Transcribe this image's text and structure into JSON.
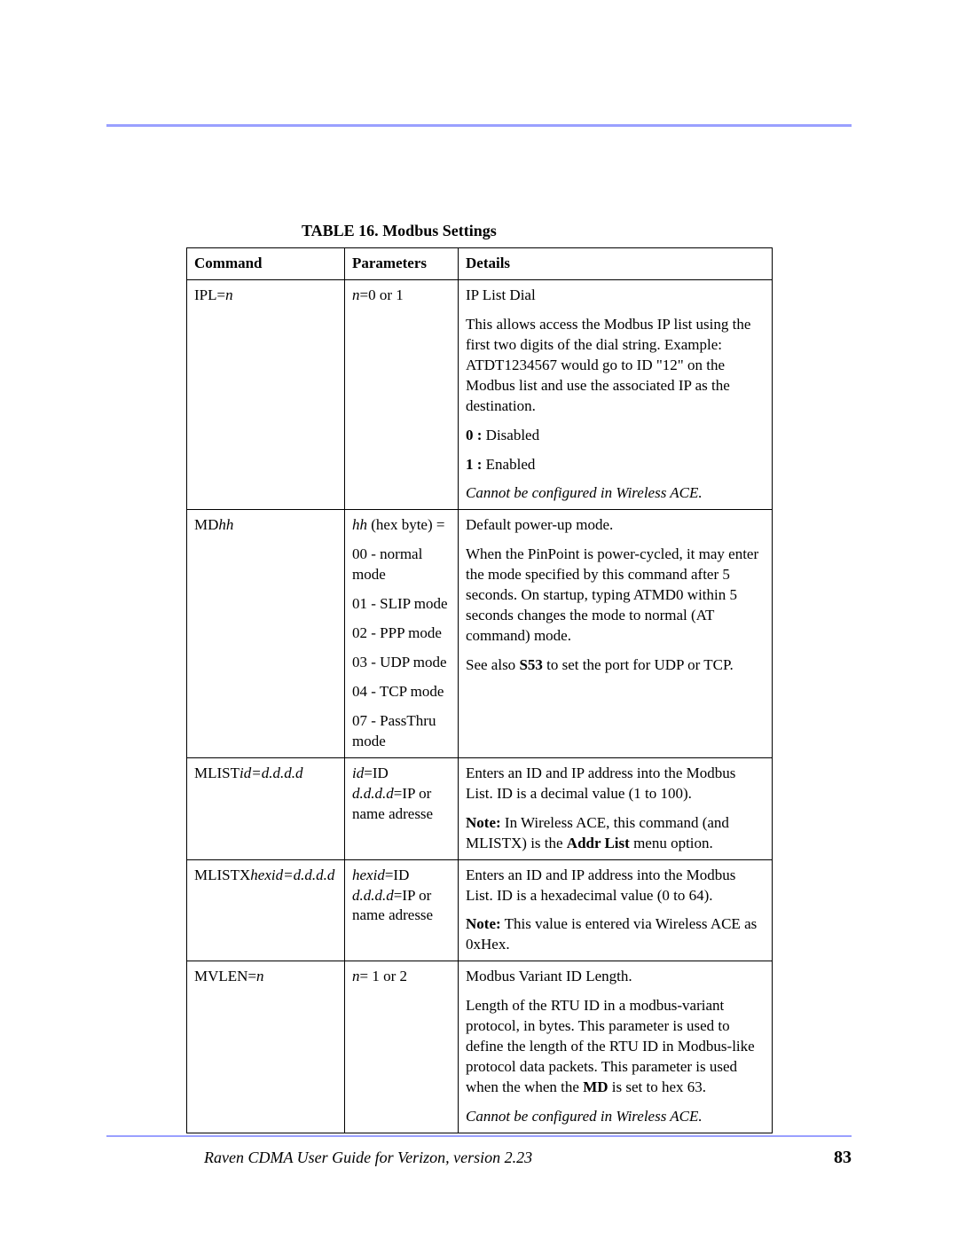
{
  "caption": {
    "label": "TABLE 16.",
    "title": "Modbus Settings"
  },
  "headers": {
    "col1": "Command",
    "col2": "Parameters",
    "col3": "Details"
  },
  "rows": {
    "ipl": {
      "cmd_prefix": "IPL=",
      "cmd_var": "n",
      "param_var": "n",
      "param_rest": "=0 or 1",
      "d1": "IP List Dial",
      "d2": "This allows access the Modbus IP list using the first two digits of the dial string. Example: ATDT1234567 would go to ID \"12\" on the Modbus list and use the associated IP as the destination.",
      "d3_b": "0 :",
      "d3_t": " Disabled",
      "d4_b": "1 :",
      "d4_t": " Enabled",
      "d5": "Cannot be configured in Wireless ACE."
    },
    "md": {
      "cmd_prefix": "MD",
      "cmd_var": "hh",
      "p1_var": "hh",
      "p1_rest": " (hex byte) =",
      "p2": "00 - normal mode",
      "p3": "01 -  SLIP mode",
      "p4": "02 -  PPP mode",
      "p5": "03 - UDP mode",
      "p6": "04 - TCP mode",
      "p7": "07 - PassThru mode",
      "d1": "Default power-up mode.",
      "d2": "When the PinPoint is power-cycled, it may enter the mode specified by this command after 5 seconds. On startup, typing ATMD0 within 5 seconds changes the mode to normal (AT command) mode.",
      "d3_a": "See also ",
      "d3_b": "S53",
      "d3_c": " to set the port for UDP or TCP."
    },
    "mlist": {
      "cmd_prefix": "MLIST",
      "cmd_var": "id=d.d.d.d",
      "p1_var": "id",
      "p1_rest": "=ID",
      "p2_var": "d.d.d.d",
      "p2_rest": "=IP or name adresse",
      "d1": "Enters an ID and IP address into the Modbus List.  ID is a decimal value (1 to 100).",
      "d2_a": "Note:",
      "d2_b": " In Wireless ACE, this command (and MLISTX) is the ",
      "d2_c": "Addr List",
      "d2_d": " menu option."
    },
    "mlistx": {
      "cmd_prefix": "MLISTX",
      "cmd_var": "hexid=d.d.d.d",
      "p1_var": "hexid",
      "p1_rest": "=ID",
      "p2_var": "d.d.d.d",
      "p2_rest": "=IP or name adresse",
      "d1": "Enters an ID and IP address into the Modbus List. ID is a hexadecimal value (0 to 64).",
      "d2_a": "Note:",
      "d2_b": " This value is entered via Wireless ACE as 0xHex."
    },
    "mvlen": {
      "cmd_prefix": "MVLEN=",
      "cmd_var": "n",
      "param_var": "n",
      "param_rest": "= 1 or 2",
      "d1": "Modbus Variant ID Length.",
      "d2_a": "Length of the RTU ID in a modbus-variant protocol, in bytes. This parameter is used to define the length of the RTU ID in Modbus-like protocol data packets. This parameter is used when the when the ",
      "d2_b": "MD",
      "d2_c": " is set to hex 63.",
      "d3": "Cannot be configured in Wireless ACE."
    }
  },
  "footer": {
    "title": "Raven CDMA User Guide for Verizon, version 2.23",
    "page": "83"
  }
}
